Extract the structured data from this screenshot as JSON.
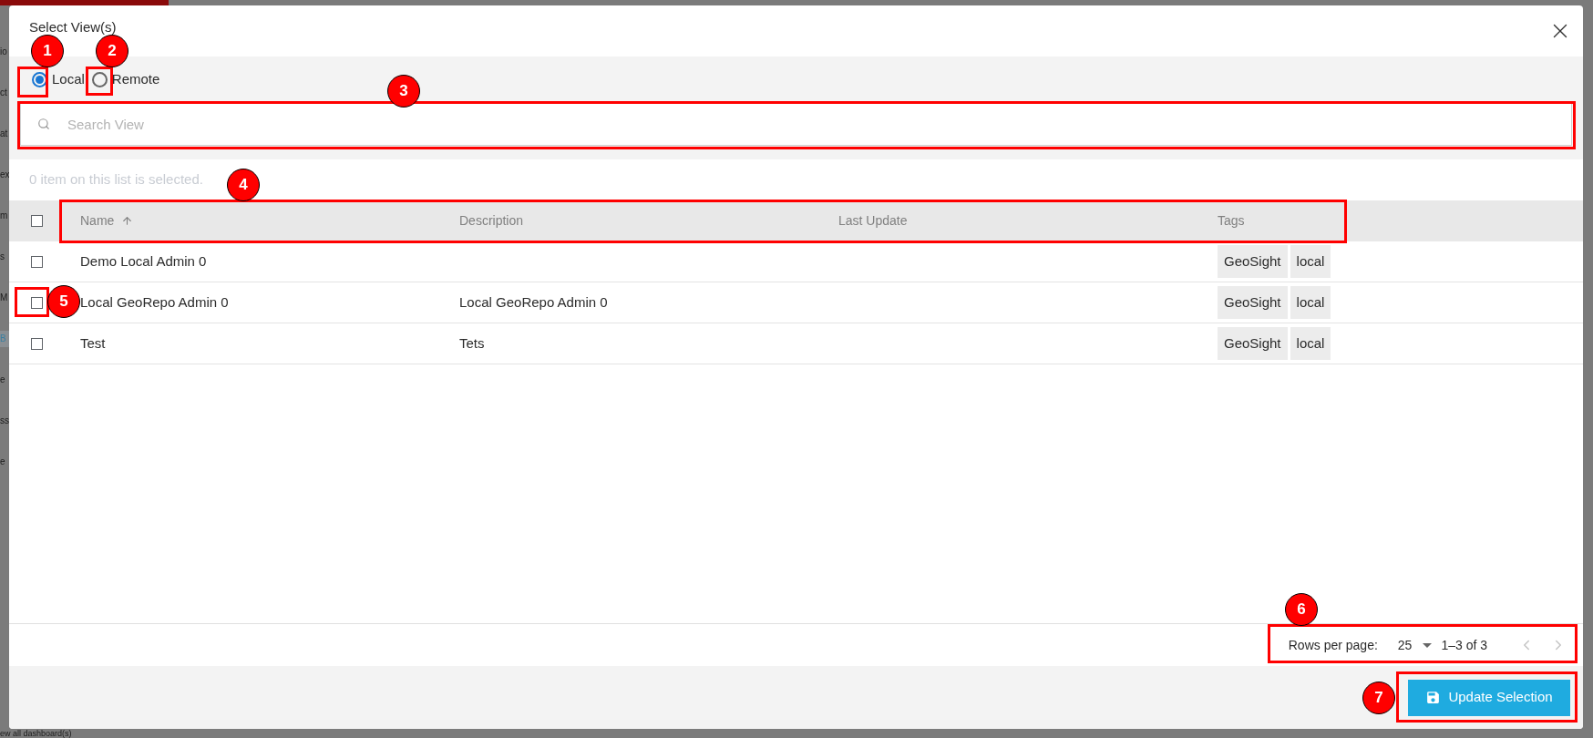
{
  "background": {
    "fragments": [
      {
        "text": "io",
        "kind": "plain"
      },
      {
        "text": "ct",
        "kind": "plain"
      },
      {
        "text": "at",
        "kind": "plain"
      },
      {
        "text": "ex",
        "kind": "plain"
      },
      {
        "text": "m",
        "kind": "plain"
      },
      {
        "text": "s",
        "kind": "plain"
      },
      {
        "text": "M",
        "kind": "plain"
      },
      {
        "text": "B",
        "kind": "link"
      },
      {
        "text": "e",
        "kind": "plain"
      },
      {
        "text": "ss",
        "kind": "plain"
      },
      {
        "text": "e",
        "kind": "plain"
      }
    ],
    "footer_link": "ew all dashboard(s)"
  },
  "dialog": {
    "title": "Select View(s)",
    "source_options": [
      {
        "label": "Local",
        "selected": true
      },
      {
        "label": "Remote",
        "selected": false
      }
    ],
    "search": {
      "placeholder": "Search View"
    },
    "selection_note": "0 item on this list is selected.",
    "table": {
      "header_checkbox": {
        "checked": false
      },
      "columns": [
        {
          "label": "Name",
          "sorted": true
        },
        {
          "label": "Description",
          "sorted": false
        },
        {
          "label": "Last Update",
          "sorted": false
        },
        {
          "label": "Tags",
          "sorted": false
        }
      ],
      "rows": [
        {
          "checked": false,
          "name": "Demo Local Admin 0",
          "tags": [
            "GeoSight",
            "local"
          ]
        },
        {
          "checked": false,
          "name": "Local GeoRepo Admin 0",
          "description": "Local GeoRepo Admin 0",
          "tags": [
            "GeoSight",
            "local"
          ]
        },
        {
          "checked": false,
          "name": "Test",
          "description": "Tets",
          "tags": [
            "GeoSight",
            "local"
          ]
        }
      ]
    },
    "pagination": {
      "rows_per_page_label": "Rows per page:",
      "rows_per_page": "25",
      "range": "1–3 of 3",
      "prev_disabled": true,
      "next_disabled": true
    },
    "primary_button": {
      "label": "Update Selection"
    }
  },
  "annotations": [
    {
      "label": "1"
    },
    {
      "label": "2"
    },
    {
      "label": "3"
    },
    {
      "label": "4"
    },
    {
      "label": "5"
    },
    {
      "label": "6"
    },
    {
      "label": "7"
    }
  ]
}
